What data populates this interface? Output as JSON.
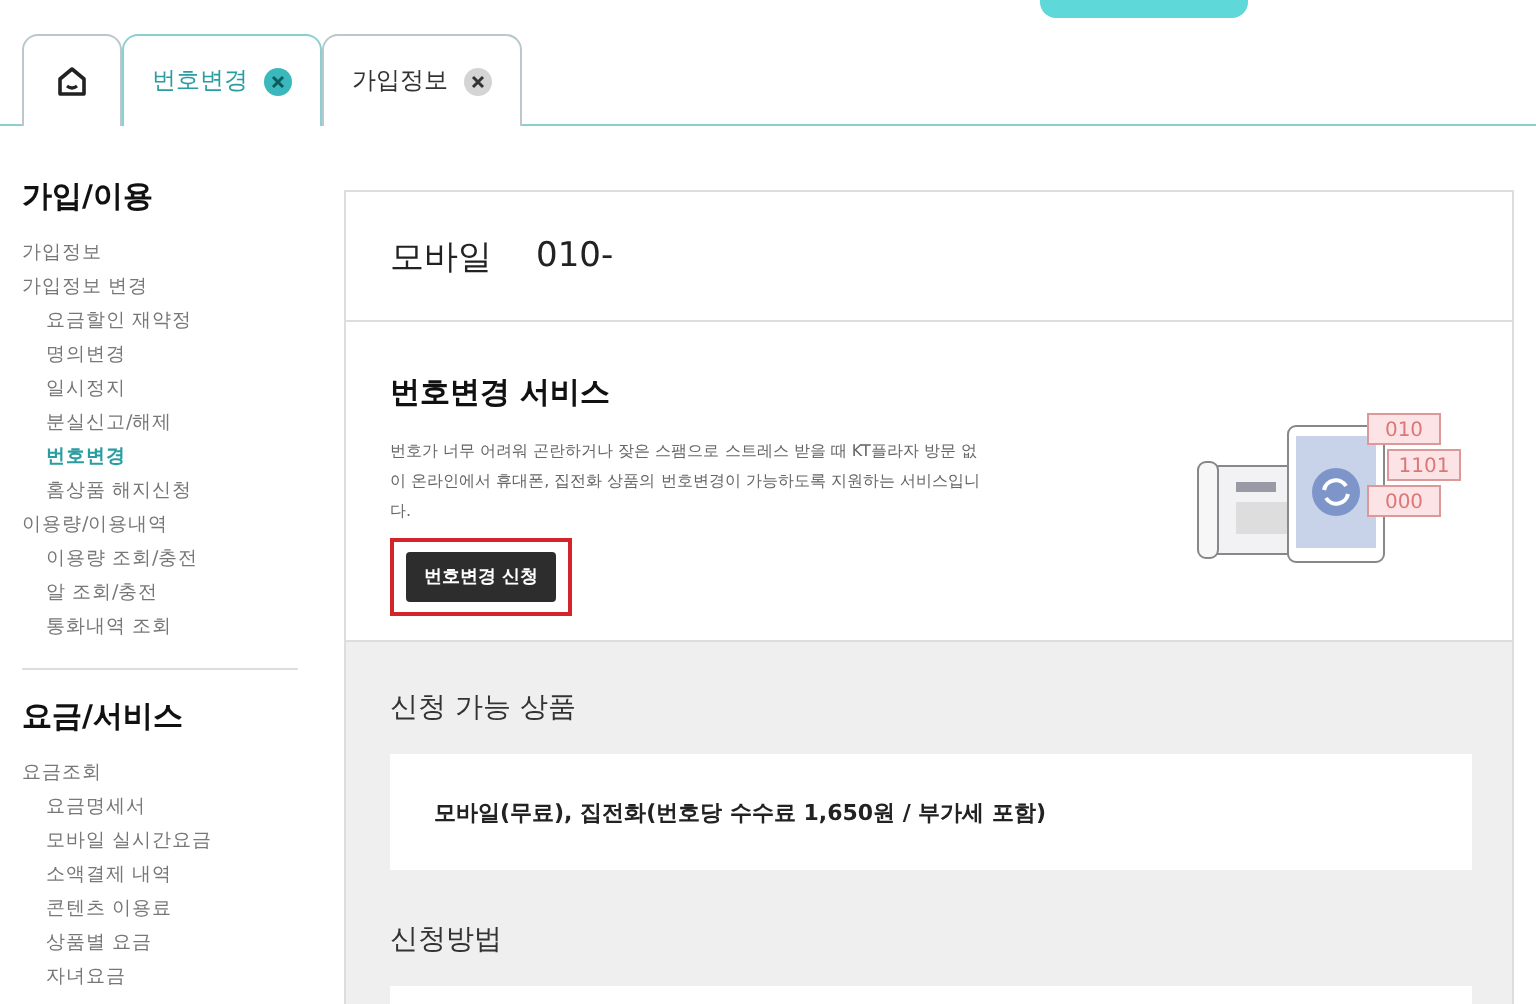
{
  "tabs": [
    {
      "kind": "home",
      "selected": false
    },
    {
      "kind": "page",
      "label": "번호변경",
      "selected": true
    },
    {
      "kind": "page",
      "label": "가입정보",
      "selected": false
    }
  ],
  "sidebar": {
    "groups": [
      {
        "title": "가입/이용",
        "items": [
          {
            "label": "가입정보",
            "selected": false
          },
          {
            "label": "가입정보 변경",
            "selected": false,
            "children": [
              {
                "label": "요금할인 재약정",
                "selected": false
              },
              {
                "label": "명의변경",
                "selected": false
              },
              {
                "label": "일시정지",
                "selected": false
              },
              {
                "label": "분실신고/해제",
                "selected": false
              },
              {
                "label": "번호변경",
                "selected": true
              },
              {
                "label": "홈상품 해지신청",
                "selected": false
              }
            ]
          },
          {
            "label": "이용량/이용내역",
            "selected": false,
            "children": [
              {
                "label": "이용량 조회/충전",
                "selected": false
              },
              {
                "label": "알 조회/충전",
                "selected": false
              },
              {
                "label": "통화내역 조회",
                "selected": false
              }
            ]
          }
        ]
      },
      {
        "title": "요금/서비스",
        "items": [
          {
            "label": "요금조회",
            "selected": false,
            "children": [
              {
                "label": "요금명세서",
                "selected": false
              },
              {
                "label": "모바일 실시간요금",
                "selected": false
              },
              {
                "label": "소액결제 내역",
                "selected": false
              },
              {
                "label": "콘텐츠 이용료",
                "selected": false
              },
              {
                "label": "상품별 요금",
                "selected": false
              },
              {
                "label": "자녀요금",
                "selected": false
              }
            ]
          }
        ]
      }
    ]
  },
  "line_card": {
    "label": "모바일",
    "number": "010-"
  },
  "service": {
    "title": "번호변경 서비스",
    "description": "번호가 너무 어려워 곤란하거나 잦은 스팸으로 스트레스 받을 때 KT플라자 방문 없이 온라인에서 휴대폰, 집전화 상품의 번호변경이 가능하도록 지원하는 서비스입니다.",
    "button": {
      "label": "번호변경 신청",
      "highlighted": true
    },
    "illustration_numbers": [
      "010",
      "1101",
      "000"
    ]
  },
  "info_sections": [
    {
      "title": "신청 가능 상품",
      "body": "모바일(무료), 집전화(번호당 수수료 1,650원 / 부가세 포함)"
    },
    {
      "title": "신청방법"
    }
  ]
}
